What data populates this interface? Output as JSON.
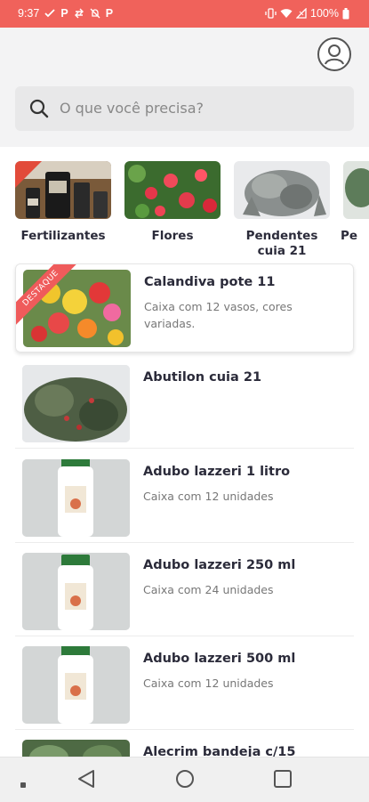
{
  "status": {
    "time": "9:37",
    "p1": "P",
    "p2": "P",
    "battery_text": "100%",
    "accent_color": "#f0625b"
  },
  "header": {
    "avatar_icon": "user-circle-icon",
    "search": {
      "placeholder": "O que você precisa?",
      "icon": "search-icon"
    }
  },
  "categories": [
    {
      "label": "Fertilizantes"
    },
    {
      "label": "Flores"
    },
    {
      "label": "Pendentes cuia 21"
    },
    {
      "label": "Pe"
    }
  ],
  "products": [
    {
      "title": "Calandiva pote 11",
      "description": "Caixa com 12 vasos, cores variadas.",
      "badge": "DESTAQUE"
    },
    {
      "title": "Abutilon cuia 21",
      "description": ""
    },
    {
      "title": "Adubo lazzeri 1 litro",
      "description": "Caixa com 12 unidades"
    },
    {
      "title": "Adubo lazzeri 250 ml",
      "description": "Caixa com 24 unidades"
    },
    {
      "title": "Adubo lazzeri 500 ml",
      "description": "Caixa com 12 unidades"
    },
    {
      "title": "Alecrim bandeja c/15",
      "description": ""
    }
  ],
  "navigation": {
    "back_icon": "back-triangle-icon",
    "home_icon": "home-circle-icon",
    "recents_icon": "recents-square-icon"
  }
}
